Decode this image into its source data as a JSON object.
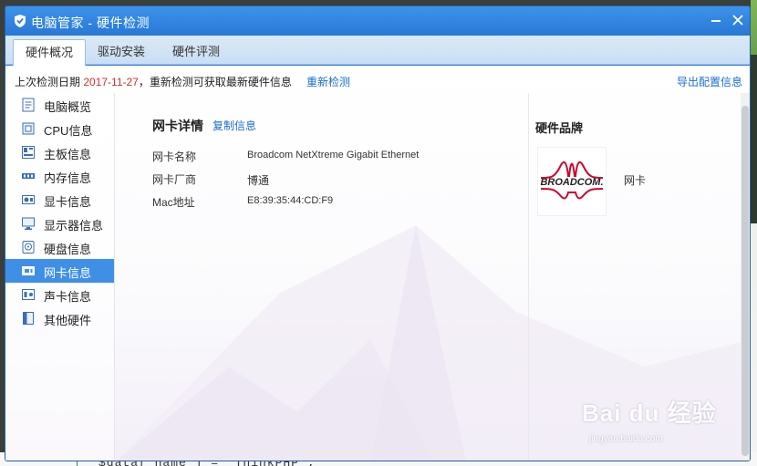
{
  "window": {
    "title": "电脑管家 - 硬件检测"
  },
  "tabs": [
    {
      "label": "硬件概况",
      "active": true
    },
    {
      "label": "驱动安装",
      "active": false
    },
    {
      "label": "硬件评测",
      "active": false
    }
  ],
  "infobar": {
    "prefix": "上次检测日期 ",
    "date": "2017-11-27",
    "suffix": "，重新检测可获取最新硬件信息",
    "recheck_label": "重新检测",
    "export_label": "导出配置信息"
  },
  "sidebar": {
    "items": [
      {
        "label": "电脑概览",
        "icon": "computer-overview-icon"
      },
      {
        "label": "CPU信息",
        "icon": "cpu-icon"
      },
      {
        "label": "主板信息",
        "icon": "motherboard-icon"
      },
      {
        "label": "内存信息",
        "icon": "memory-icon"
      },
      {
        "label": "显卡信息",
        "icon": "graphics-card-icon"
      },
      {
        "label": "显示器信息",
        "icon": "monitor-icon"
      },
      {
        "label": "硬盘信息",
        "icon": "hard-disk-icon"
      },
      {
        "label": "网卡信息",
        "icon": "network-card-icon",
        "active": true
      },
      {
        "label": "声卡信息",
        "icon": "sound-card-icon"
      },
      {
        "label": "其他硬件",
        "icon": "other-hardware-icon"
      }
    ]
  },
  "detail": {
    "title": "网卡详情",
    "copy_label": "复制信息",
    "rows": [
      {
        "label": "网卡名称",
        "value": "Broadcom NetXtreme Gigabit Ethernet"
      },
      {
        "label": "网卡厂商",
        "value": "博通"
      },
      {
        "label": "Mac地址",
        "value": "E8:39:35:44:CD:F9"
      }
    ]
  },
  "brand": {
    "title": "硬件品牌",
    "logo_text": "BROADCOM.",
    "type": "网卡"
  },
  "watermark": {
    "main": "Bai du 经验",
    "sub": "jingyan.baidu.com"
  },
  "background_code": "$data['name'] = 'ThinkPHP';",
  "colors": {
    "accent": "#2f7fdc",
    "active_item": "#3f8fe6",
    "date": "#d03030",
    "link": "#1a6ecf",
    "broadcom_red": "#cc092f"
  }
}
